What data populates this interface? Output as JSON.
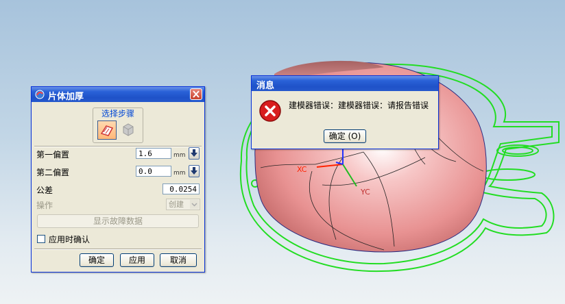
{
  "thicken_dialog": {
    "title": "片体加厚",
    "group_label": "选择步骤",
    "offset1": {
      "label": "第一偏置",
      "value": "1.6",
      "unit": "mm"
    },
    "offset2": {
      "label": "第二偏置",
      "value": "0.0",
      "unit": "mm"
    },
    "tolerance": {
      "label": "公差",
      "value": "0.0254"
    },
    "operation": {
      "label": "操作",
      "selected": "创建"
    },
    "show_fault_button": "显示故障数据",
    "confirm_on_apply": {
      "label": "应用时确认",
      "checked": false
    },
    "buttons": {
      "ok": "确定",
      "apply": "应用",
      "cancel": "取消"
    }
  },
  "message_dialog": {
    "title": "消息",
    "text": "建模器错误：建模器错误：请报告错误",
    "ok_button": "确定 (O)"
  },
  "viewport": {
    "axis_labels": {
      "x": "XC",
      "y": "YC"
    },
    "colors": {
      "part": "#e89a9a",
      "curve": "#22dd22",
      "axis_x": "#ff2200",
      "axis_y": "#22bb22",
      "axis_z": "#2233ff"
    }
  }
}
